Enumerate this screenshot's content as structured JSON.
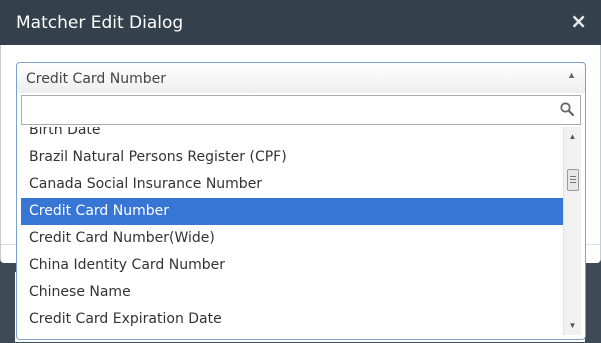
{
  "dialog": {
    "title": "Matcher Edit Dialog",
    "close_label": "×"
  },
  "select": {
    "value": "Credit Card Number",
    "arrow": "▲"
  },
  "search": {
    "value": "",
    "placeholder": "",
    "icon": "search-icon"
  },
  "options": [
    {
      "label": "Birth Date",
      "selected": false
    },
    {
      "label": "Brazil Natural Persons Register (CPF)",
      "selected": false
    },
    {
      "label": "Canada Social Insurance Number",
      "selected": false
    },
    {
      "label": "Credit Card Number",
      "selected": true
    },
    {
      "label": "Credit Card Number(Wide)",
      "selected": false
    },
    {
      "label": "China Identity Card Number",
      "selected": false
    },
    {
      "label": "Chinese Name",
      "selected": false
    },
    {
      "label": "Credit Card Expiration Date",
      "selected": false
    }
  ],
  "scrollbar": {
    "up": "▲",
    "down": "▼"
  },
  "colors": {
    "header_bg": "#34414c",
    "selected_bg": "#3876d6",
    "border_accent": "#7ea1c8"
  }
}
